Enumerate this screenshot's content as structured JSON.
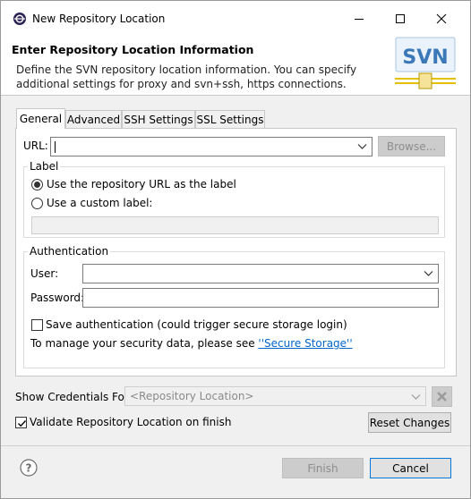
{
  "window": {
    "title": "New Repository Location"
  },
  "banner": {
    "title": "Enter Repository Location Information",
    "description": "Define the SVN repository location information. You can specify additional settings for proxy and svn+ssh, https connections.",
    "logo_text": "SVN"
  },
  "tabs": [
    {
      "label": "General",
      "active": true
    },
    {
      "label": "Advanced",
      "active": false
    },
    {
      "label": "SSH Settings",
      "active": false
    },
    {
      "label": "SSL Settings",
      "active": false
    }
  ],
  "general": {
    "url_label": "URL:",
    "url_value": "",
    "browse_label": "Browse...",
    "label_group": {
      "legend": "Label",
      "option_use_url": "Use the repository URL as the label",
      "option_custom": "Use a custom label:",
      "custom_value": ""
    },
    "auth_group": {
      "legend": "Authentication",
      "user_label": "User:",
      "user_value": "",
      "password_label": "Password:",
      "password_value": "",
      "save_auth_label": "Save authentication (could trigger secure storage login)",
      "manage_text": "To manage your security data, please see ",
      "secure_storage_link": "''Secure Storage''"
    }
  },
  "credentials": {
    "label": "Show Credentials For:",
    "selected": "<Repository Location>"
  },
  "validate": {
    "label": "Validate Repository Location on finish",
    "checked": true
  },
  "buttons": {
    "reset": "Reset Changes",
    "finish": "Finish",
    "cancel": "Cancel"
  }
}
